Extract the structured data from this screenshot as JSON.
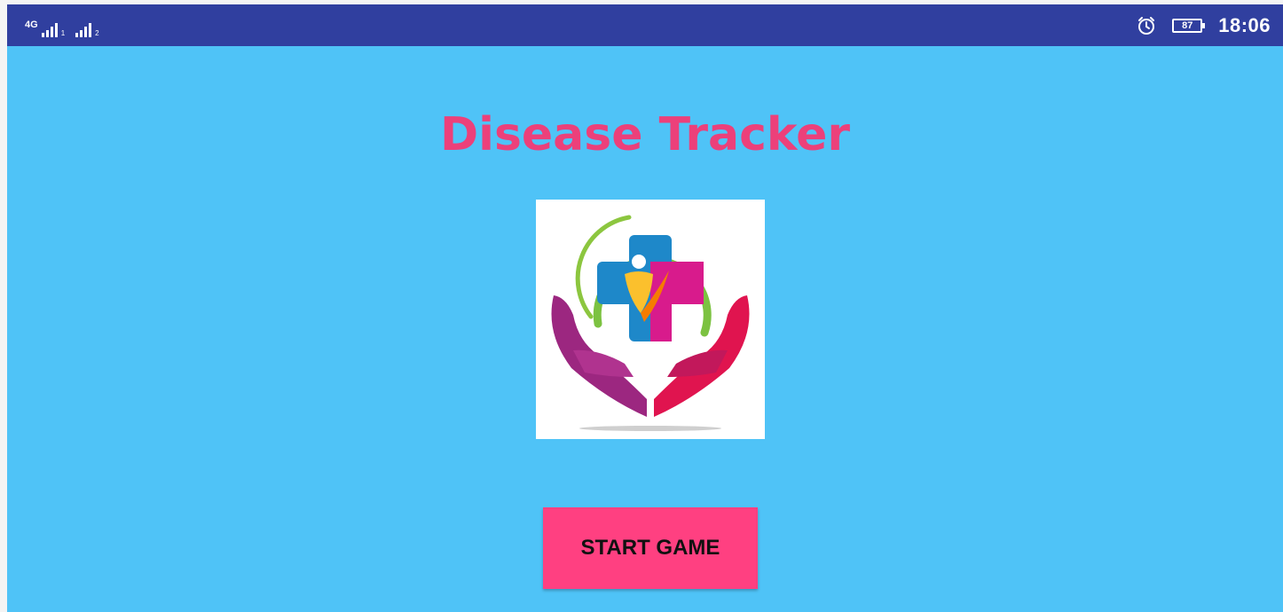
{
  "status_bar": {
    "network_label": "4G",
    "sim1_index": "1",
    "sim2_index": "2",
    "alarm_icon": "alarm-clock-icon",
    "battery_level": "87",
    "time": "18:06"
  },
  "app": {
    "title": "Disease Tracker",
    "logo_icon": "healthcare-cross-hands-logo",
    "start_button_label": "START GAME"
  },
  "colors": {
    "status_bar_bg": "#303f9f",
    "content_bg": "#4fc3f7",
    "title_color": "#ec407a",
    "button_bg": "#ff4081"
  }
}
